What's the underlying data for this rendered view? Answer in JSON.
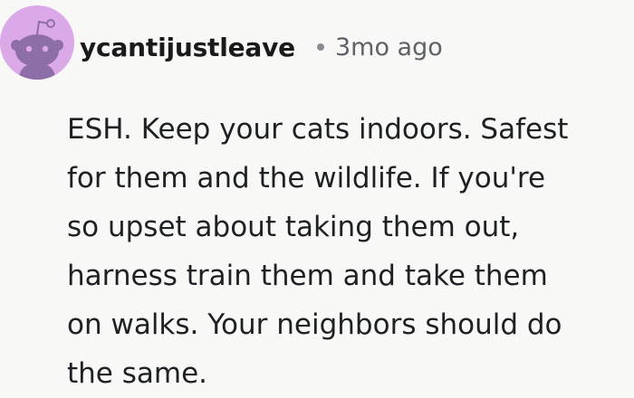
{
  "comment": {
    "author": "ycantijustleave",
    "separator": "•",
    "timestamp": "3mo ago",
    "avatar_icon": "snoo-avatar-icon",
    "avatar_color": "#dba8e8",
    "lines": [
      "ESH. Keep your cats indoors. Safest",
      "for them and the wildlife. If you're",
      "so upset about taking them out,",
      "harness train them and take them",
      "on walks. Your neighbors should do",
      "the same."
    ]
  }
}
